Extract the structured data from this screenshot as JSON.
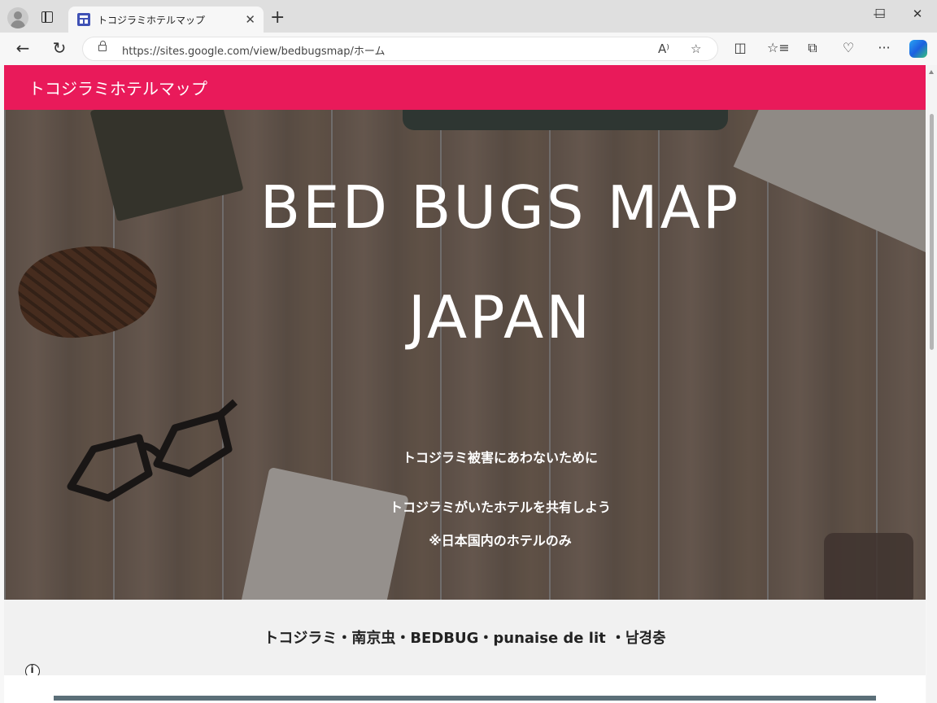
{
  "browser": {
    "tab": {
      "title": "トコジラミホテルマップ",
      "close": "✕"
    },
    "new_tab": "+",
    "window_controls": {
      "minimize": "—",
      "maximize": "☐",
      "close": "✕"
    },
    "address": {
      "url": "https://sites.google.com/view/bedbugsmap/ホーム"
    },
    "nav": {
      "back": "←",
      "reload": "↻"
    },
    "icons": [
      "read-aloud-icon",
      "favorite-star-icon",
      "split-screen-icon",
      "favorites-icon",
      "collections-icon",
      "browser-essentials-icon",
      "more-icon",
      "copilot-icon"
    ],
    "toolbar_glyphs": {
      "read_aloud": "A⁾",
      "favorite": "☆",
      "split": "◫",
      "favorites": "☆≡",
      "collections": "⧉",
      "essentials": "♡",
      "more": "···"
    }
  },
  "site": {
    "title": "トコジラミホテルマップ",
    "accent_color": "#e91a5a",
    "hero": {
      "title_line1": "BED BUGS MAP",
      "title_line2": "JAPAN",
      "line1": "トコジラミ被害にあわないために",
      "line2": "トコジラミがいたホテルを共有しよう",
      "line3": "※日本国内のホテルのみ"
    },
    "names_line": "トコジラミ・南京虫・BEDBUG・punaise de lit ・남경충"
  }
}
